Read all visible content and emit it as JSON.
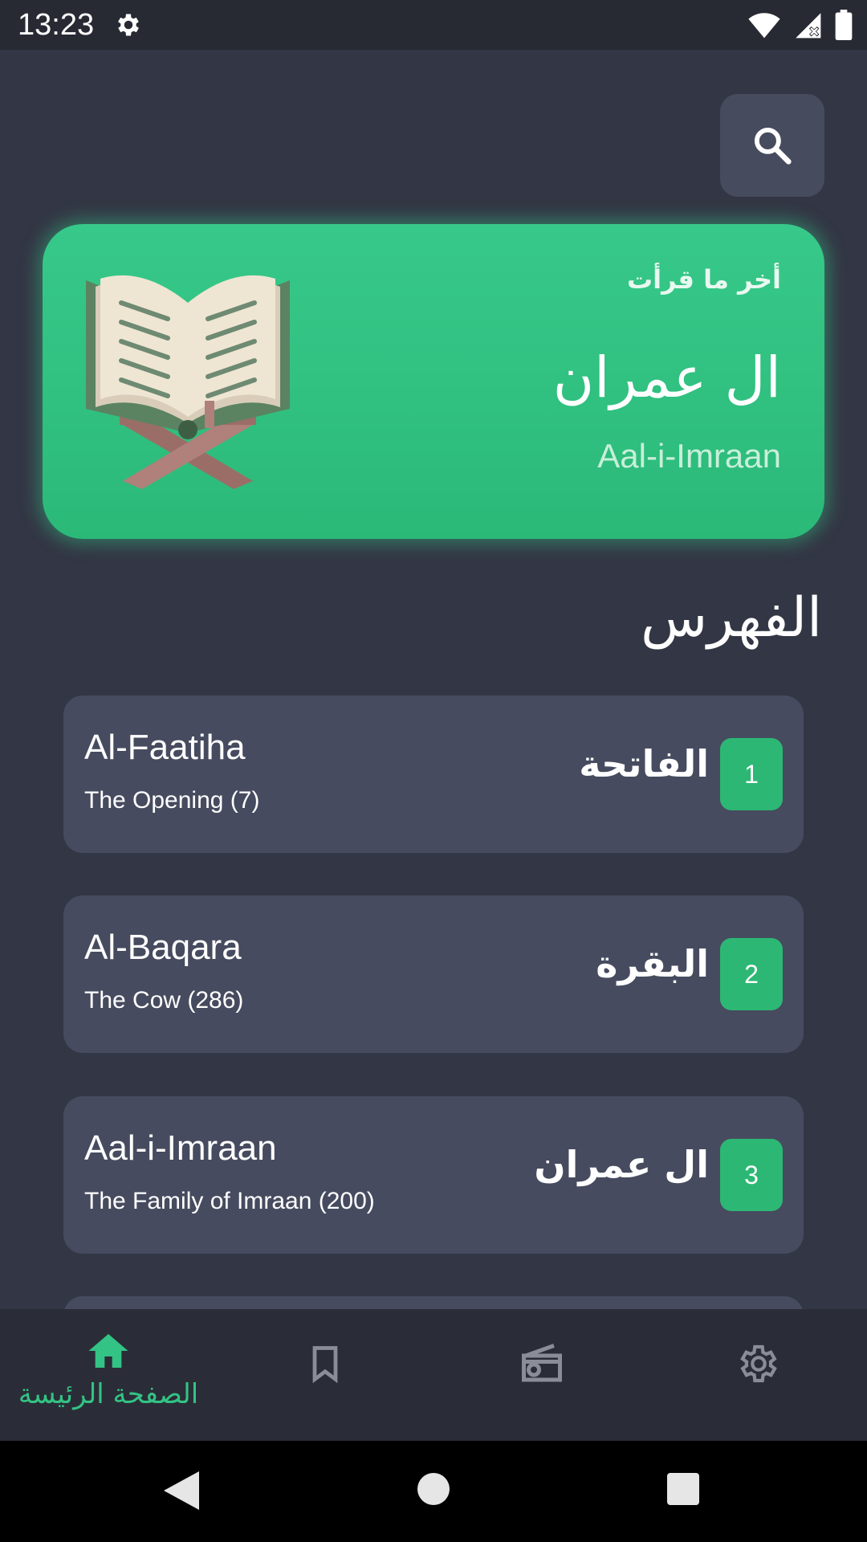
{
  "status_bar": {
    "time": "13:23",
    "icons": [
      "gear-icon",
      "wifi-icon",
      "signal-icon",
      "battery-icon"
    ]
  },
  "header": {
    "search_icon": "search-icon"
  },
  "last_read": {
    "label": "أخر ما قرأت",
    "surah_ar": "ال عمران",
    "surah_en": "Aal-i-Imraan",
    "image": "quran-book-icon"
  },
  "index": {
    "title": "الفهرس"
  },
  "surahs": [
    {
      "number": "1",
      "name_ar": "الفاتحة",
      "name_en": "Al-Faatiha",
      "subtitle": "The Opening (7)"
    },
    {
      "number": "2",
      "name_ar": "البقرة",
      "name_en": "Al-Baqara",
      "subtitle": "The Cow (286)"
    },
    {
      "number": "3",
      "name_ar": "ال عمران",
      "name_en": "Aal-i-Imraan",
      "subtitle": "The Family of Imraan (200)"
    }
  ],
  "bottom_nav": {
    "items": [
      {
        "icon": "home-icon",
        "label": "الصفحة الرئيسة",
        "active": true
      },
      {
        "icon": "bookmark-icon",
        "label": "",
        "active": false
      },
      {
        "icon": "radio-icon",
        "label": "",
        "active": false
      },
      {
        "icon": "settings-icon",
        "label": "",
        "active": false
      }
    ]
  },
  "colors": {
    "accent": "#2cb874",
    "background": "#333644",
    "card": "#474b5f",
    "nav": "#2a2d37"
  }
}
